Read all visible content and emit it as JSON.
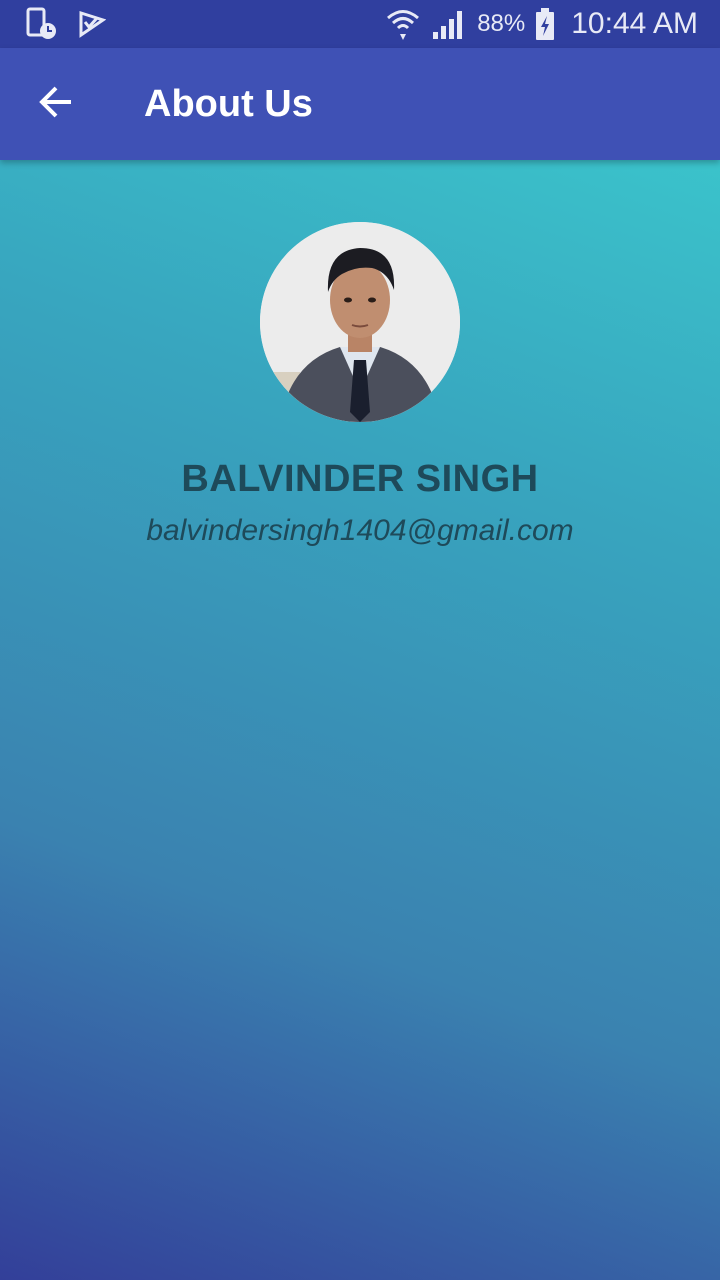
{
  "status_bar": {
    "battery_percent": "88%",
    "time": "10:44 AM",
    "icons": [
      "phone-schedule-icon",
      "check-flag-icon",
      "wifi-icon",
      "signal-icon",
      "battery-charging-icon"
    ]
  },
  "app_bar": {
    "title": "About Us",
    "back_icon": "arrow-left-icon"
  },
  "profile": {
    "name": "BALVINDER SINGH",
    "email": "balvindersingh1404@gmail.com",
    "avatar_icon": "profile-photo"
  },
  "colors": {
    "status_bar": "#303f9f",
    "app_bar": "#3f51b5",
    "gradient_top": "#3ccfd0",
    "gradient_bottom": "#333f99",
    "text_dark": "#1e4a5a"
  }
}
